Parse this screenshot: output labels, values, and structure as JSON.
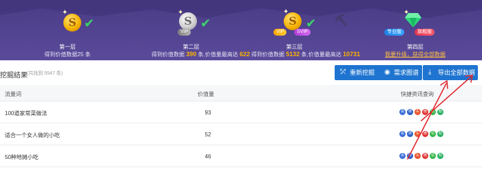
{
  "tiers": [
    {
      "label": "第一层",
      "desc_prefix": "得到价值数据",
      "desc_count": "25",
      "desc_suffix": "条"
    },
    {
      "label": "第二层",
      "badges": [
        "VIP"
      ],
      "desc_prefix": "得到价值数据",
      "desc_count": "390",
      "desc_mid": "条,价值量最高达",
      "desc_max": "622"
    },
    {
      "label": "第三层",
      "badges": [
        "VIP",
        "SVIP"
      ],
      "desc_prefix": "得到价值数据",
      "desc_count": "5132",
      "desc_mid": "条,价值量最高达",
      "desc_max": "10731"
    },
    {
      "label": "第四层",
      "badges": [
        "专业版",
        "旗舰版"
      ],
      "desc_link": "我要升级，获得全部数据"
    }
  ],
  "toolbar": {
    "title": "挖掘结果",
    "count": "(共找到 5547 条)",
    "rescan_label": "重新挖掘",
    "demand_label": "需求图谱",
    "export_label": "导出全部数据"
  },
  "table": {
    "headers": [
      "流量词",
      "价值量",
      "快捷资讯查询"
    ],
    "rows": [
      {
        "keyword": "100道家常菜做法",
        "value": "93"
      },
      {
        "keyword": "适合一个女人做的小吃",
        "value": "52"
      },
      {
        "keyword": "50种地摊小吃",
        "value": "46"
      }
    ]
  },
  "colors": {
    "banner": "#4a3c86",
    "accent_blue": "#1e74d0",
    "highlight": "#ffb400",
    "check_green": "#3ad46a",
    "arrow_red": "#e0282e"
  }
}
